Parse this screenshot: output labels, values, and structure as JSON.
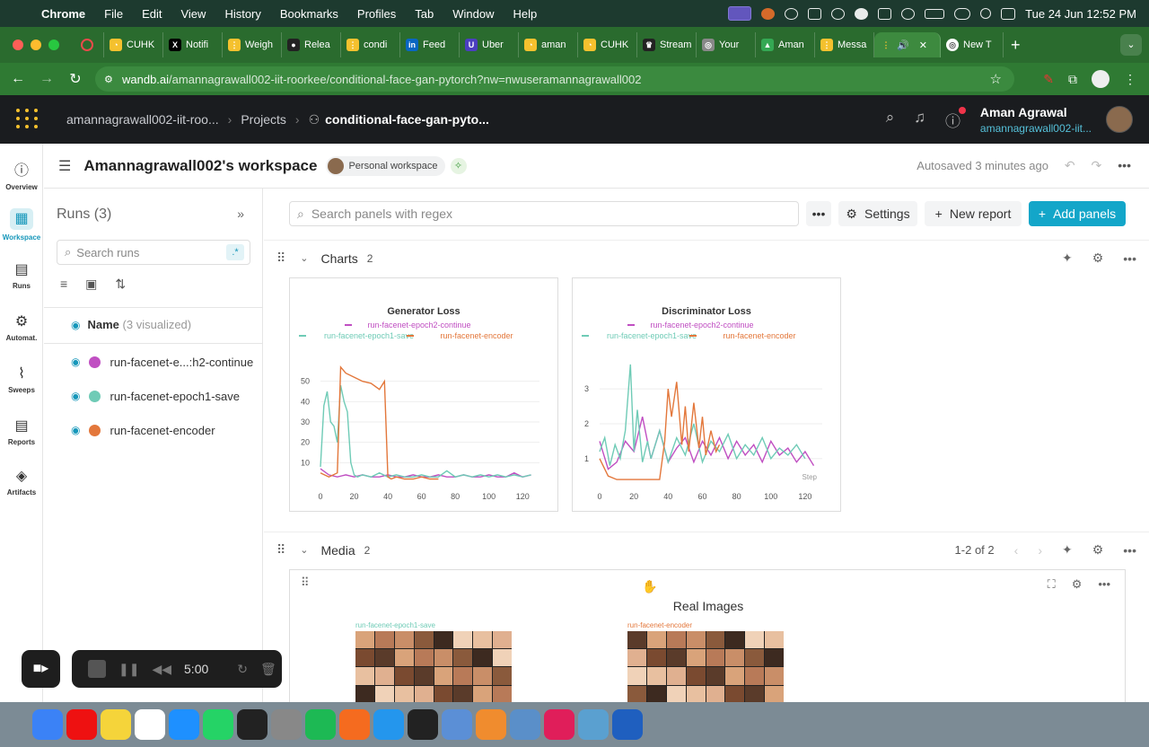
{
  "menubar": {
    "app": "Chrome",
    "items": [
      "File",
      "Edit",
      "View",
      "History",
      "Bookmarks",
      "Profiles",
      "Tab",
      "Window",
      "Help"
    ],
    "clock": "Tue 24 Jun  12:52 PM"
  },
  "tabs": [
    {
      "label": "CUHK",
      "color": "#f5c12e",
      "glyph": "◔"
    },
    {
      "label": "Notifi",
      "color": "#000000",
      "glyph": "X"
    },
    {
      "label": "Weigh",
      "color": "#f5c12e",
      "glyph": "⋮"
    },
    {
      "label": "Relea",
      "color": "#222222",
      "glyph": "●"
    },
    {
      "label": "condi",
      "color": "#f5c12e",
      "glyph": "⋮"
    },
    {
      "label": "Feed",
      "color": "#0a66c2",
      "glyph": "in"
    },
    {
      "label": "Uber",
      "color": "#4b3fbf",
      "glyph": "U"
    },
    {
      "label": "aman",
      "color": "#f5c12e",
      "glyph": "◔"
    },
    {
      "label": "CUHK",
      "color": "#f5c12e",
      "glyph": "◔"
    },
    {
      "label": "Stream",
      "color": "#222222",
      "glyph": "♛"
    },
    {
      "label": "Your",
      "color": "#888888",
      "glyph": "◎"
    },
    {
      "label": "Aman",
      "color": "#34a853",
      "glyph": "▲"
    },
    {
      "label": "Messa",
      "color": "#f5c12e",
      "glyph": "⋮"
    }
  ],
  "active_tab": {
    "label": "",
    "glyph": "⋮"
  },
  "new_tab": {
    "label": "New T"
  },
  "address": {
    "host": "wandb.ai",
    "path": "/amannagrawall002-iit-roorkee/conditional-face-gan-pytorch?nw=nwuseramannagrawall002"
  },
  "wb_header": {
    "org": "amannagrawall002-iit-roo...",
    "projects": "Projects",
    "project": "conditional-face-gan-pyto...",
    "user_name": "Aman Agrawal",
    "user_email": "amannagrawall002-iit..."
  },
  "leftnav": [
    {
      "label": "Overview",
      "icon": "info-icon",
      "glyph": "ⓘ"
    },
    {
      "label": "Workspace",
      "icon": "workspace-icon",
      "glyph": "▦"
    },
    {
      "label": "Runs",
      "icon": "table-icon",
      "glyph": "▤"
    },
    {
      "label": "Automat.",
      "icon": "automation-icon",
      "glyph": "⚙"
    },
    {
      "label": "Sweeps",
      "icon": "broom-icon",
      "glyph": "⌇"
    },
    {
      "label": "Reports",
      "icon": "report-icon",
      "glyph": "▤"
    },
    {
      "label": "Artifacts",
      "icon": "layers-icon",
      "glyph": "◈"
    }
  ],
  "workspace": {
    "title": "Amannagrawall002's workspace",
    "badge": "Personal workspace",
    "autosave": "Autosaved 3 minutes ago"
  },
  "runs_panel": {
    "title": "Runs (3)",
    "search_placeholder": "Search runs",
    "regex_label": ".*",
    "name_header": "Name",
    "visualized": "(3 visualized)",
    "runs": [
      {
        "name": "run-facenet-e...:h2-continue",
        "color": "#c04fc2"
      },
      {
        "name": "run-facenet-epoch1-save",
        "color": "#6fcbb6"
      },
      {
        "name": "run-facenet-encoder",
        "color": "#e3773b"
      }
    ]
  },
  "toolbar": {
    "search_placeholder": "Search panels with regex",
    "settings": "Settings",
    "new_report": "New report",
    "add_panels": "Add panels"
  },
  "sections": {
    "charts": {
      "title": "Charts",
      "count": "2"
    },
    "media": {
      "title": "Media",
      "count": "2",
      "pager": "1-2 of 2"
    }
  },
  "series_names": [
    "run-facenet-epoch2-continue",
    "run-facenet-epoch1-save",
    "run-facenet-encoder"
  ],
  "series_colors": [
    "#c04fc2",
    "#6fcbb6",
    "#e3773b"
  ],
  "chart_data": [
    {
      "type": "line",
      "title": "Generator Loss",
      "xlabel": "",
      "ylabel": "",
      "xlim": [
        0,
        130
      ],
      "ylim": [
        0,
        60
      ],
      "xticks": [
        0,
        20,
        40,
        60,
        80,
        100,
        120
      ],
      "yticks": [
        10,
        20,
        30,
        40,
        50
      ],
      "grid": true,
      "legend": "top",
      "series": [
        {
          "name": "run-facenet-epoch2-continue",
          "x": [
            0,
            5,
            10,
            15,
            20,
            25,
            30,
            35,
            40,
            45,
            50,
            55,
            60,
            65,
            70,
            75,
            80,
            85,
            90,
            95,
            100,
            105,
            110,
            115,
            120,
            125
          ],
          "y": [
            7,
            4,
            3,
            4,
            3,
            4,
            3,
            3,
            4,
            3,
            3,
            4,
            3,
            3,
            4,
            3,
            3,
            4,
            3,
            3,
            4,
            3,
            3,
            5,
            3,
            4
          ]
        },
        {
          "name": "run-facenet-epoch1-save",
          "x": [
            0,
            2,
            4,
            6,
            8,
            10,
            12,
            14,
            16,
            18,
            20,
            22,
            25,
            30,
            35,
            40,
            45,
            50,
            55,
            60,
            65,
            70,
            75,
            80,
            85,
            90,
            95,
            100,
            105,
            110,
            115,
            120,
            125
          ],
          "y": [
            8,
            38,
            45,
            30,
            28,
            20,
            48,
            40,
            35,
            10,
            4,
            3,
            4,
            3,
            5,
            3,
            4,
            3,
            3,
            4,
            3,
            3,
            6,
            3,
            4,
            3,
            4,
            3,
            4,
            3,
            4,
            3,
            4
          ]
        },
        {
          "name": "run-facenet-encoder",
          "x": [
            0,
            5,
            10,
            12,
            15,
            20,
            25,
            30,
            35,
            38,
            40,
            42,
            45,
            50,
            55,
            60,
            65,
            70
          ],
          "y": [
            5,
            3,
            5,
            57,
            54,
            52,
            50,
            49,
            46,
            50,
            3,
            2,
            3,
            2,
            2,
            3,
            2,
            2
          ]
        }
      ]
    },
    {
      "type": "line",
      "title": "Discriminator Loss",
      "xlabel": "Step",
      "ylabel": "",
      "xlim": [
        0,
        130
      ],
      "ylim": [
        0.3,
        3.8
      ],
      "xticks": [
        0,
        20,
        40,
        60,
        80,
        100,
        120
      ],
      "yticks": [
        1,
        2,
        3
      ],
      "grid": true,
      "legend": "top",
      "series": [
        {
          "name": "run-facenet-epoch2-continue",
          "x": [
            0,
            5,
            10,
            15,
            20,
            25,
            30,
            35,
            40,
            45,
            50,
            55,
            60,
            65,
            70,
            75,
            80,
            85,
            90,
            95,
            100,
            105,
            110,
            115,
            120,
            125
          ],
          "y": [
            1.5,
            0.7,
            0.9,
            1.5,
            1.2,
            2.2,
            1.0,
            1.8,
            0.9,
            1.3,
            1.6,
            0.9,
            1.5,
            1.1,
            1.6,
            1.0,
            1.5,
            1.1,
            1.4,
            0.9,
            1.5,
            1.1,
            1.3,
            0.9,
            1.2,
            0.8
          ]
        },
        {
          "name": "run-facenet-epoch1-save",
          "x": [
            0,
            3,
            6,
            9,
            12,
            15,
            18,
            20,
            22,
            25,
            28,
            30,
            35,
            40,
            45,
            50,
            55,
            60,
            65,
            70,
            75,
            80,
            85,
            90,
            95,
            100,
            105,
            110,
            115,
            120
          ],
          "y": [
            1.2,
            1.6,
            0.8,
            1.4,
            1.0,
            1.8,
            3.7,
            1.2,
            2.4,
            0.9,
            1.5,
            1.0,
            1.8,
            0.9,
            1.6,
            1.1,
            2.0,
            0.9,
            1.5,
            1.2,
            1.7,
            1.0,
            1.4,
            1.1,
            1.6,
            1.0,
            1.3,
            1.1,
            1.4,
            1.0
          ]
        },
        {
          "name": "run-facenet-encoder",
          "x": [
            0,
            5,
            10,
            15,
            20,
            25,
            30,
            35,
            38,
            40,
            42,
            45,
            48,
            50,
            52,
            55,
            58,
            60,
            62,
            65,
            68,
            70
          ],
          "y": [
            1.0,
            0.5,
            0.4,
            0.4,
            0.4,
            0.4,
            0.4,
            0.4,
            1.5,
            3.0,
            2.2,
            3.2,
            1.4,
            2.5,
            1.2,
            2.6,
            1.3,
            2.2,
            1.1,
            1.8,
            1.2,
            1.4
          ]
        }
      ]
    }
  ],
  "media": {
    "title": "Real Images",
    "left_run": "run-facenet-epoch1-save",
    "right_run": "run-facenet-encoder"
  },
  "recorder": {
    "time": "5:00"
  }
}
